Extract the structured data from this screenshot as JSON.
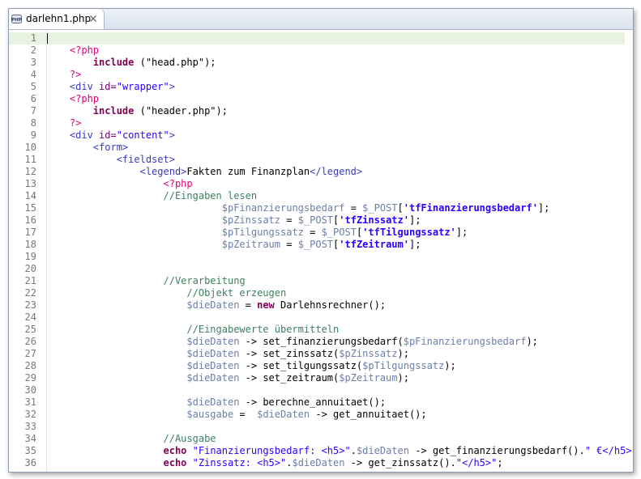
{
  "tab": {
    "title": "darlehn1.php",
    "icon": "php-file-icon",
    "close_icon": "close-icon"
  },
  "lines": [
    {
      "n": "1",
      "indent": "",
      "tokens": []
    },
    {
      "n": "2",
      "indent": "    ",
      "tokens": [
        {
          "t": "<?php",
          "c": "php"
        }
      ]
    },
    {
      "n": "3",
      "indent": "        ",
      "tokens": [
        {
          "t": "include",
          "c": "kw"
        },
        {
          "t": " (",
          "c": ""
        },
        {
          "t": "\"head.php\"",
          "c": ""
        },
        {
          "t": ");",
          "c": ""
        }
      ]
    },
    {
      "n": "4",
      "indent": "    ",
      "tokens": [
        {
          "t": "?>",
          "c": "php"
        }
      ]
    },
    {
      "n": "5",
      "indent": "    ",
      "tokens": [
        {
          "t": "<div ",
          "c": "tag"
        },
        {
          "t": "id=",
          "c": "attr"
        },
        {
          "t": "\"wrapper\"",
          "c": "str"
        },
        {
          "t": ">",
          "c": "tag"
        }
      ]
    },
    {
      "n": "6",
      "indent": "    ",
      "tokens": [
        {
          "t": "<?php",
          "c": "php"
        }
      ]
    },
    {
      "n": "7",
      "indent": "        ",
      "tokens": [
        {
          "t": "include",
          "c": "kw"
        },
        {
          "t": " (",
          "c": ""
        },
        {
          "t": "\"header.php\"",
          "c": ""
        },
        {
          "t": ");",
          "c": ""
        }
      ]
    },
    {
      "n": "8",
      "indent": "    ",
      "tokens": [
        {
          "t": "?>",
          "c": "php"
        }
      ]
    },
    {
      "n": "9",
      "indent": "    ",
      "tokens": [
        {
          "t": "<div ",
          "c": "tag"
        },
        {
          "t": "id=",
          "c": "attr"
        },
        {
          "t": "\"content\"",
          "c": "str"
        },
        {
          "t": ">",
          "c": "tag"
        }
      ]
    },
    {
      "n": "10",
      "indent": "        ",
      "tokens": [
        {
          "t": "<form>",
          "c": "tag"
        }
      ]
    },
    {
      "n": "11",
      "indent": "            ",
      "tokens": [
        {
          "t": "<fieldset>",
          "c": "tag"
        }
      ]
    },
    {
      "n": "12",
      "indent": "                ",
      "tokens": [
        {
          "t": "<legend>",
          "c": "tag"
        },
        {
          "t": "Fakten zum Finanzplan",
          "c": ""
        },
        {
          "t": "</legend>",
          "c": "tag"
        }
      ]
    },
    {
      "n": "13",
      "indent": "                    ",
      "tokens": [
        {
          "t": "<?php",
          "c": "php"
        }
      ]
    },
    {
      "n": "14",
      "indent": "                    ",
      "tokens": [
        {
          "t": "//Eingaben lesen",
          "c": "com"
        }
      ]
    },
    {
      "n": "15",
      "indent": "                              ",
      "tokens": [
        {
          "t": "$pFinanzierungsbedarf",
          "c": "var"
        },
        {
          "t": " = ",
          "c": ""
        },
        {
          "t": "$_POST",
          "c": "var"
        },
        {
          "t": "[",
          "c": ""
        },
        {
          "t": "'tfFinanzierungsbedarf'",
          "c": "key"
        },
        {
          "t": "];",
          "c": ""
        }
      ]
    },
    {
      "n": "16",
      "indent": "                              ",
      "tokens": [
        {
          "t": "$pZinssatz",
          "c": "var"
        },
        {
          "t": " = ",
          "c": ""
        },
        {
          "t": "$_POST",
          "c": "var"
        },
        {
          "t": "[",
          "c": ""
        },
        {
          "t": "'tfZinssatz'",
          "c": "key"
        },
        {
          "t": "];",
          "c": ""
        }
      ]
    },
    {
      "n": "17",
      "indent": "                              ",
      "tokens": [
        {
          "t": "$pTilgungssatz",
          "c": "var"
        },
        {
          "t": " = ",
          "c": ""
        },
        {
          "t": "$_POST",
          "c": "var"
        },
        {
          "t": "[",
          "c": ""
        },
        {
          "t": "'tfTilgungssatz'",
          "c": "key"
        },
        {
          "t": "];",
          "c": ""
        }
      ]
    },
    {
      "n": "18",
      "indent": "                              ",
      "tokens": [
        {
          "t": "$pZeitraum",
          "c": "var"
        },
        {
          "t": " = ",
          "c": ""
        },
        {
          "t": "$_POST",
          "c": "var"
        },
        {
          "t": "[",
          "c": ""
        },
        {
          "t": "'tfZeitraum'",
          "c": "key"
        },
        {
          "t": "];",
          "c": ""
        }
      ]
    },
    {
      "n": "19",
      "indent": "",
      "tokens": []
    },
    {
      "n": "20",
      "indent": "",
      "tokens": []
    },
    {
      "n": "21",
      "indent": "                    ",
      "tokens": [
        {
          "t": "//Verarbeitung",
          "c": "com"
        }
      ]
    },
    {
      "n": "22",
      "indent": "                        ",
      "tokens": [
        {
          "t": "//Objekt erzeugen",
          "c": "com"
        }
      ]
    },
    {
      "n": "23",
      "indent": "                        ",
      "tokens": [
        {
          "t": "$dieDaten",
          "c": "var"
        },
        {
          "t": " = ",
          "c": ""
        },
        {
          "t": "new",
          "c": "kw"
        },
        {
          "t": " Darlehnsrechner();",
          "c": ""
        }
      ]
    },
    {
      "n": "24",
      "indent": "",
      "tokens": []
    },
    {
      "n": "25",
      "indent": "                        ",
      "tokens": [
        {
          "t": "//Eingabewerte übermitteln",
          "c": "com"
        }
      ]
    },
    {
      "n": "26",
      "indent": "                        ",
      "tokens": [
        {
          "t": "$dieDaten",
          "c": "var"
        },
        {
          "t": " -> set_finanzierungsbedarf(",
          "c": ""
        },
        {
          "t": "$pFinanzierungsbedarf",
          "c": "var"
        },
        {
          "t": ");",
          "c": ""
        }
      ]
    },
    {
      "n": "27",
      "indent": "                        ",
      "tokens": [
        {
          "t": "$dieDaten",
          "c": "var"
        },
        {
          "t": " -> set_zinssatz(",
          "c": ""
        },
        {
          "t": "$pZinssatz",
          "c": "var"
        },
        {
          "t": ");",
          "c": ""
        }
      ]
    },
    {
      "n": "28",
      "indent": "                        ",
      "tokens": [
        {
          "t": "$dieDaten",
          "c": "var"
        },
        {
          "t": " -> set_tilgungssatz(",
          "c": ""
        },
        {
          "t": "$pTilgungssatz",
          "c": "var"
        },
        {
          "t": ");",
          "c": ""
        }
      ]
    },
    {
      "n": "29",
      "indent": "                        ",
      "tokens": [
        {
          "t": "$dieDaten",
          "c": "var"
        },
        {
          "t": " -> set_zeitraum(",
          "c": ""
        },
        {
          "t": "$pZeitraum",
          "c": "var"
        },
        {
          "t": ");",
          "c": ""
        }
      ]
    },
    {
      "n": "30",
      "indent": "",
      "tokens": []
    },
    {
      "n": "31",
      "indent": "                        ",
      "tokens": [
        {
          "t": "$dieDaten",
          "c": "var"
        },
        {
          "t": " -> berechne_annuitaet();",
          "c": ""
        }
      ]
    },
    {
      "n": "32",
      "indent": "                        ",
      "tokens": [
        {
          "t": "$ausgabe",
          "c": "var"
        },
        {
          "t": " =  ",
          "c": ""
        },
        {
          "t": "$dieDaten",
          "c": "var"
        },
        {
          "t": " -> get_annuitaet();",
          "c": ""
        }
      ]
    },
    {
      "n": "33",
      "indent": "",
      "tokens": []
    },
    {
      "n": "34",
      "indent": "                    ",
      "tokens": [
        {
          "t": "//Ausgabe",
          "c": "com"
        }
      ]
    },
    {
      "n": "35",
      "indent": "                    ",
      "tokens": [
        {
          "t": "echo",
          "c": "kw"
        },
        {
          "t": " ",
          "c": ""
        },
        {
          "t": "\"Finanzierungsbedarf: <h5>\"",
          "c": "str"
        },
        {
          "t": ".",
          "c": ""
        },
        {
          "t": "$dieDaten",
          "c": "var"
        },
        {
          "t": " -> get_finanzierungsbedarf().",
          "c": ""
        },
        {
          "t": "\" €</h5>\"",
          "c": "str"
        },
        {
          "t": ";",
          "c": ""
        }
      ]
    },
    {
      "n": "36",
      "indent": "                    ",
      "tokens": [
        {
          "t": "echo",
          "c": "kw"
        },
        {
          "t": " ",
          "c": ""
        },
        {
          "t": "\"Zinssatz: <h5>\"",
          "c": "str"
        },
        {
          "t": ".",
          "c": ""
        },
        {
          "t": "$dieDaten",
          "c": "var"
        },
        {
          "t": " -> get_zinssatz().",
          "c": ""
        },
        {
          "t": "\"</h5>\"",
          "c": "str"
        },
        {
          "t": ";",
          "c": ""
        }
      ]
    }
  ],
  "current_line": "1"
}
